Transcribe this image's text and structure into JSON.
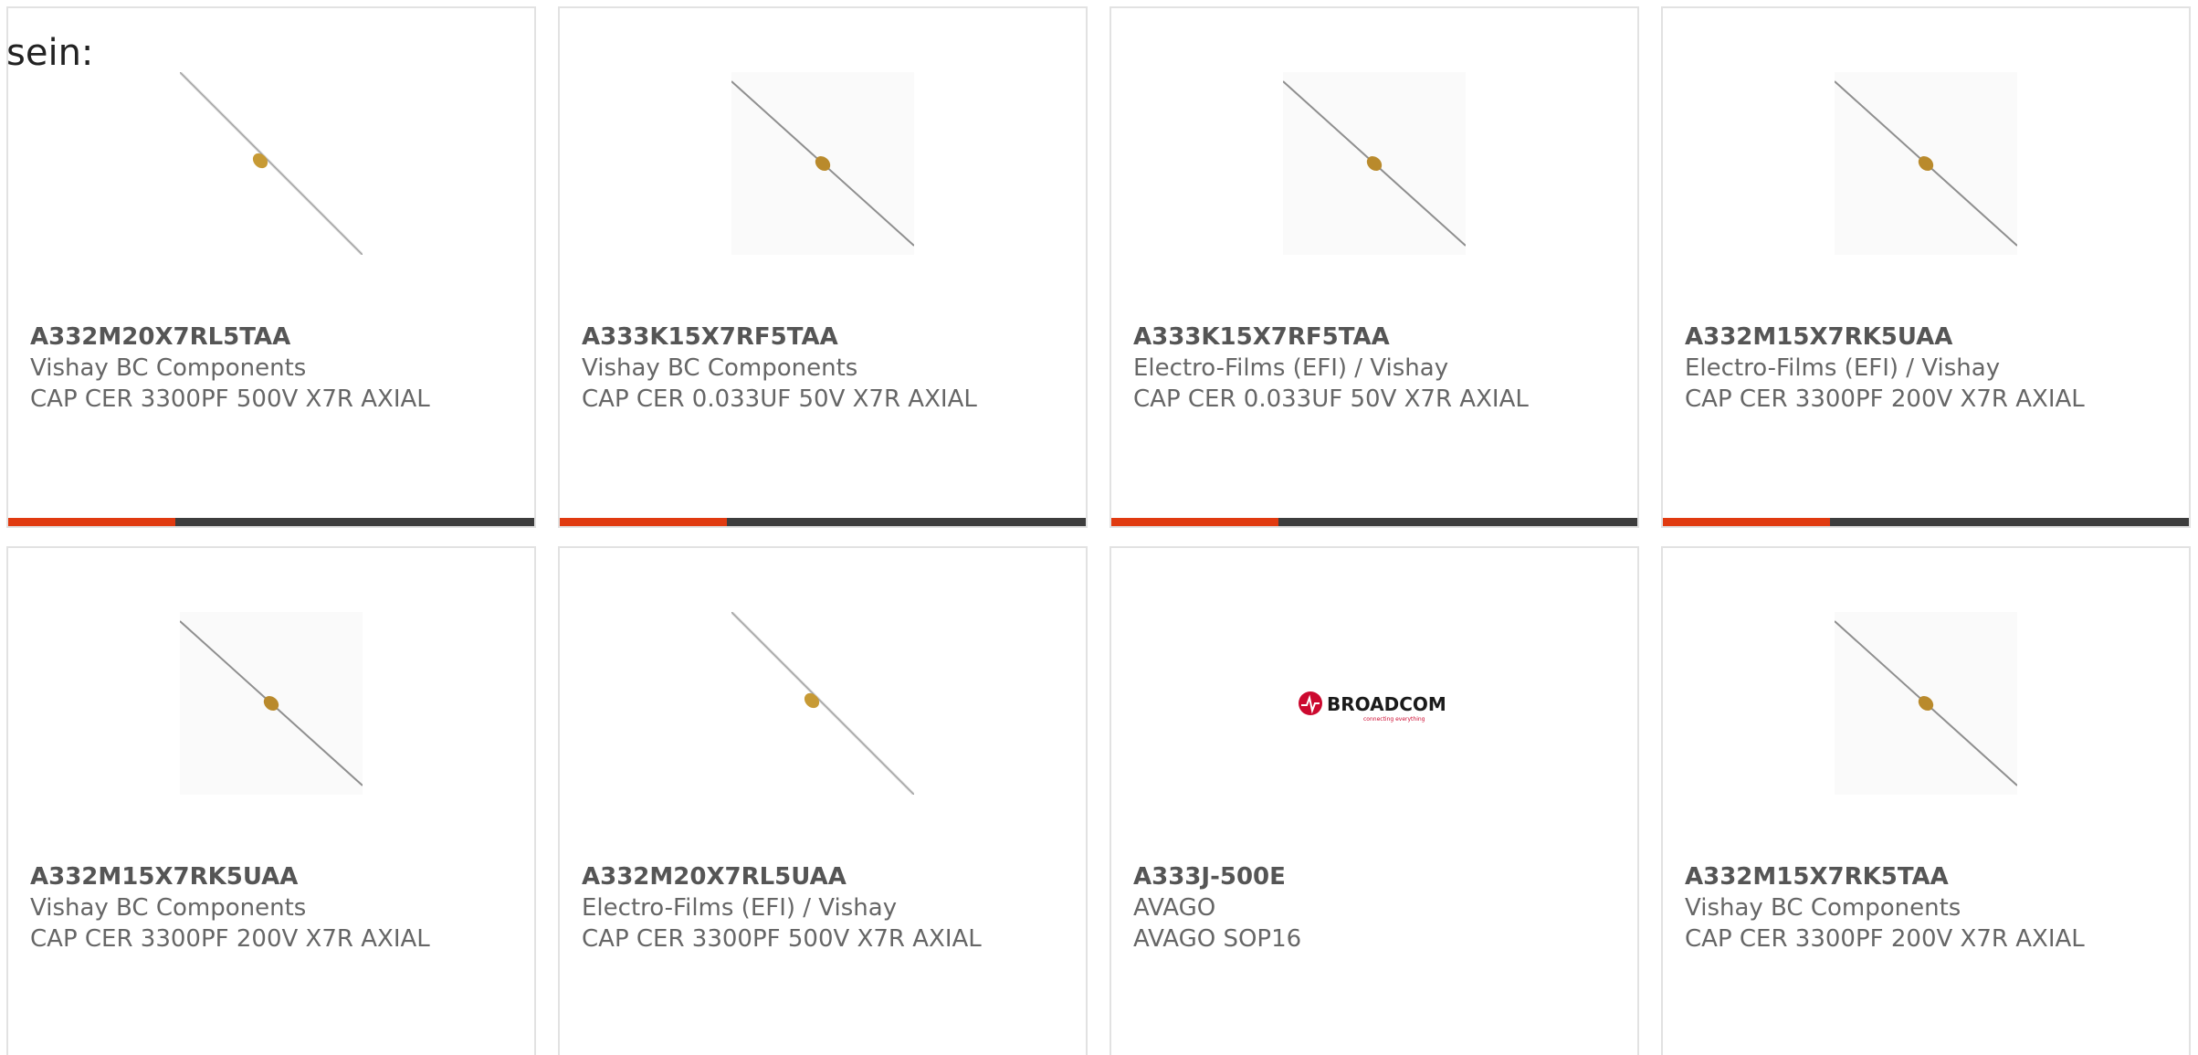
{
  "intro_text": "sein:",
  "colors": {
    "accent": "#e03a10",
    "bar_dark": "#3d3d3d",
    "card_border": "#e2e2e2",
    "broadcom_red": "#cc092f"
  },
  "cards": [
    {
      "part_number": "A332M20X7RL5TAA",
      "manufacturer": "Vishay BC Components",
      "description": "CAP CER 3300PF 500V X7R AXIAL",
      "image": "axial-capacitor-icon"
    },
    {
      "part_number": "A333K15X7RF5TAA",
      "manufacturer": "Vishay BC Components",
      "description": "CAP CER 0.033UF 50V X7R AXIAL",
      "image": "axial-capacitor-icon"
    },
    {
      "part_number": "A333K15X7RF5TAA",
      "manufacturer": "Electro-Films (EFI) / Vishay",
      "description": "CAP CER 0.033UF 50V X7R AXIAL",
      "image": "axial-capacitor-icon"
    },
    {
      "part_number": "A332M15X7RK5UAA",
      "manufacturer": "Electro-Films (EFI) / Vishay",
      "description": "CAP CER 3300PF 200V X7R AXIAL",
      "image": "axial-capacitor-icon"
    },
    {
      "part_number": "A332M15X7RK5UAA",
      "manufacturer": "Vishay BC Components",
      "description": "CAP CER 3300PF 200V X7R AXIAL",
      "image": "axial-capacitor-icon"
    },
    {
      "part_number": "A332M20X7RL5UAA",
      "manufacturer": "Electro-Films (EFI) / Vishay",
      "description": "CAP CER 3300PF 500V X7R AXIAL",
      "image": "axial-capacitor-icon"
    },
    {
      "part_number": "A333J-500E",
      "manufacturer": "AVAGO",
      "description": "AVAGO SOP16",
      "image": "broadcom-logo",
      "logo_text": "BROADCOM",
      "logo_tagline": "connecting everything"
    },
    {
      "part_number": "A332M15X7RK5TAA",
      "manufacturer": "Vishay BC Components",
      "description": "CAP CER 3300PF 200V X7R AXIAL",
      "image": "axial-capacitor-icon"
    }
  ]
}
